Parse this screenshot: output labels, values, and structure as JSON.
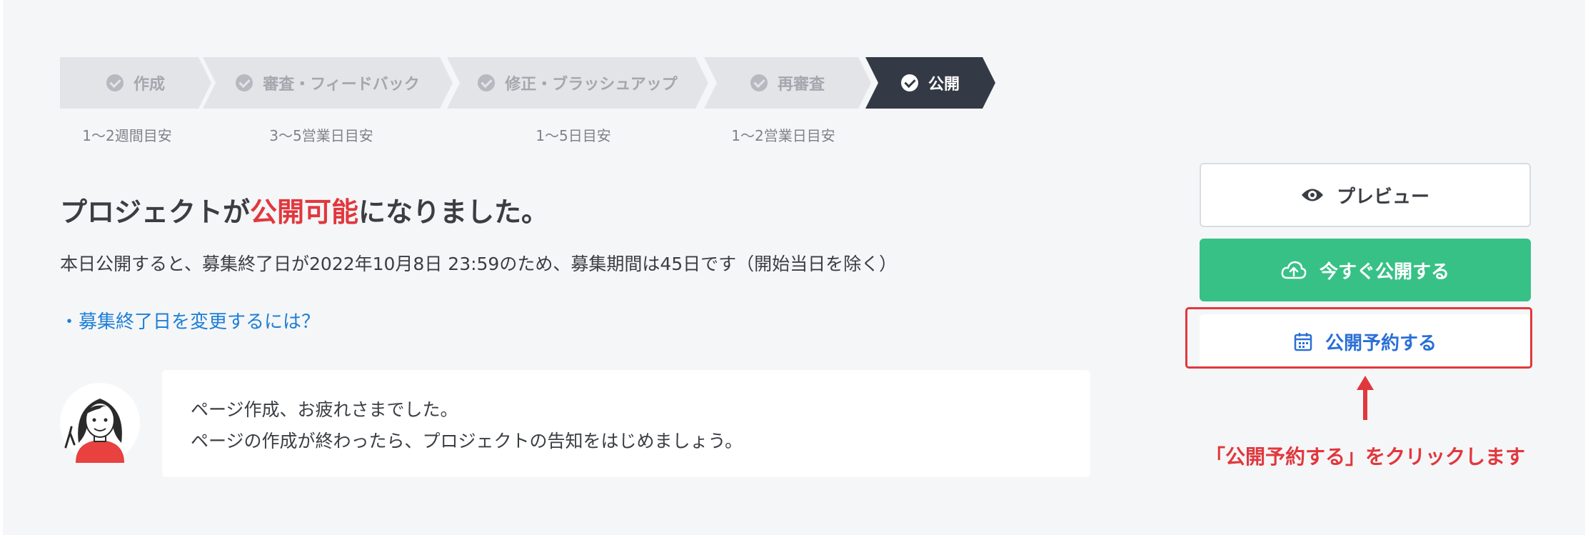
{
  "stepper": {
    "steps": [
      {
        "label": "作成",
        "estimate": "1〜2週間目安",
        "state": "done"
      },
      {
        "label": "審査・フィードバック",
        "estimate": "3〜5営業日目安",
        "state": "done"
      },
      {
        "label": "修正・ブラッシュアップ",
        "estimate": "1〜5日目安",
        "state": "done"
      },
      {
        "label": "再審査",
        "estimate": "1〜2営業日目安",
        "state": "done"
      },
      {
        "label": "公開",
        "estimate": "",
        "state": "active"
      }
    ]
  },
  "main": {
    "headline_pre": "プロジェクトが",
    "headline_highlight": "公開可能",
    "headline_post": "になりました。",
    "subtext": "本日公開すると、募集終了日が2022年10月8日 23:59のため、募集期間は45日です（開始当日を除く）",
    "help_link": "・募集終了日を変更するには？"
  },
  "message": {
    "line1": "ページ作成、お疲れさまでした。",
    "line2": "ページの作成が終わったら、プロジェクトの告知をはじめましょう。"
  },
  "actions": {
    "preview_label": "プレビュー",
    "publish_now_label": "今すぐ公開する",
    "schedule_label": "公開予約する"
  },
  "annotation": {
    "callout": "「公開予約する」をクリックします"
  },
  "icons": {
    "preview": "eye-icon",
    "publish_now": "cloud-upload-icon",
    "schedule": "calendar-icon",
    "step_done": "check-circle-icon"
  },
  "colors": {
    "accent_red": "#e0383d",
    "publish_green": "#37c186",
    "link_blue": "#1e7fd6",
    "active_step": "#343a45",
    "inactive_step": "#e3e4e8"
  }
}
